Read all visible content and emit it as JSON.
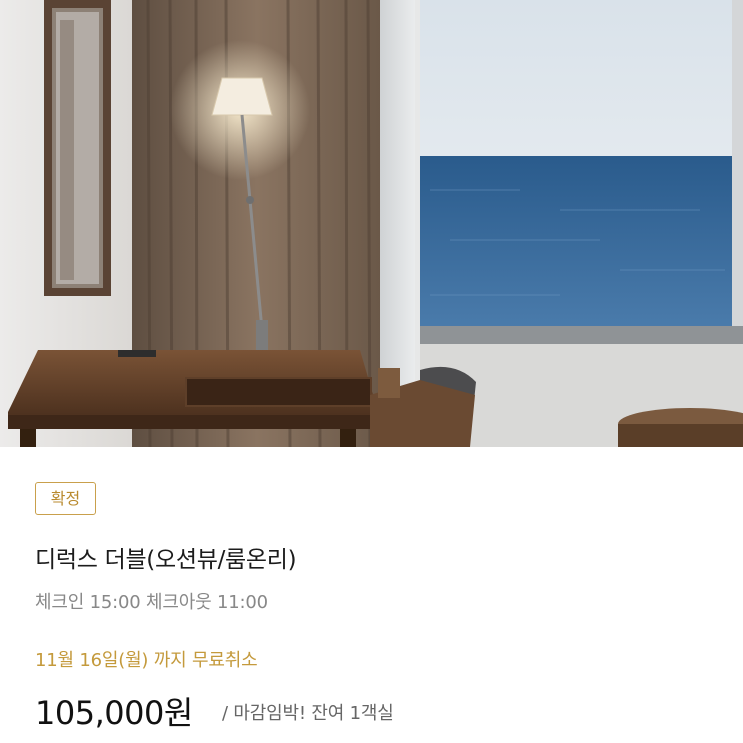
{
  "room": {
    "status_badge": "확정",
    "name": "디럭스 더블(오션뷰/룸온리)",
    "checkin_checkout": "체크인 15:00 체크아웃 11:00",
    "free_cancellation": "11월 16일(월) 까지 무료취소",
    "price": "105,000원",
    "availability_note": "/ 마감임박! 잔여 1객실"
  },
  "colors": {
    "accent_gold": "#c49a3c",
    "text_dark": "#1c1c1c",
    "text_gray": "#888888"
  }
}
